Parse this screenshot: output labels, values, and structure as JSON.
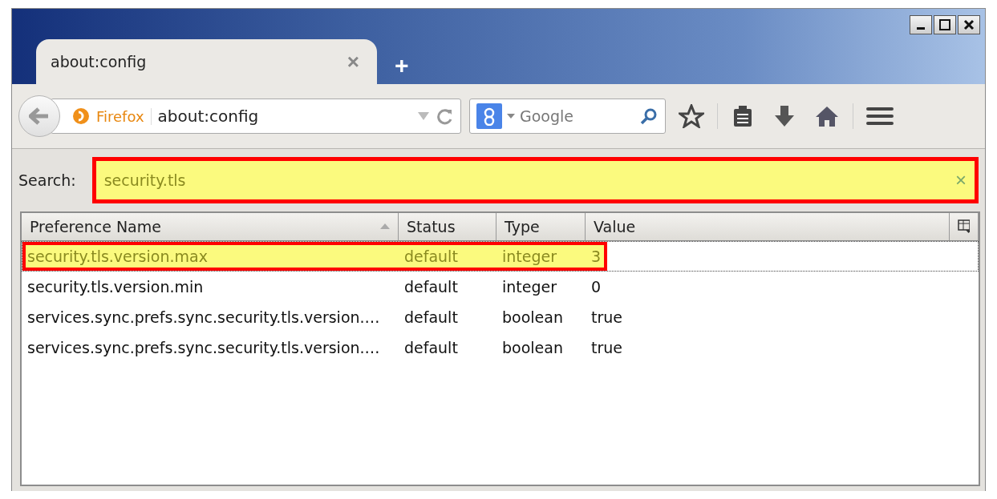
{
  "tab": {
    "title": "about:config",
    "close": "×",
    "new_tab": "+"
  },
  "url_bar": {
    "identity": "Firefox",
    "value": "about:config"
  },
  "search_bar": {
    "placeholder": "Google"
  },
  "filter": {
    "label": "Search:",
    "value": "security.tls",
    "clear": "×",
    "highlighted": true
  },
  "table": {
    "columns": [
      "Preference Name",
      "Status",
      "Type",
      "Value"
    ],
    "rows": [
      {
        "name": "security.tls.version.max",
        "status": "default",
        "type": "integer",
        "value": "3",
        "selected": true
      },
      {
        "name": "security.tls.version.min",
        "status": "default",
        "type": "integer",
        "value": "0",
        "selected": false
      },
      {
        "name": "services.sync.prefs.sync.security.tls.version.…",
        "status": "default",
        "type": "boolean",
        "value": "true",
        "selected": false
      },
      {
        "name": "services.sync.prefs.sync.security.tls.version.…",
        "status": "default",
        "type": "boolean",
        "value": "true",
        "selected": false
      }
    ]
  }
}
